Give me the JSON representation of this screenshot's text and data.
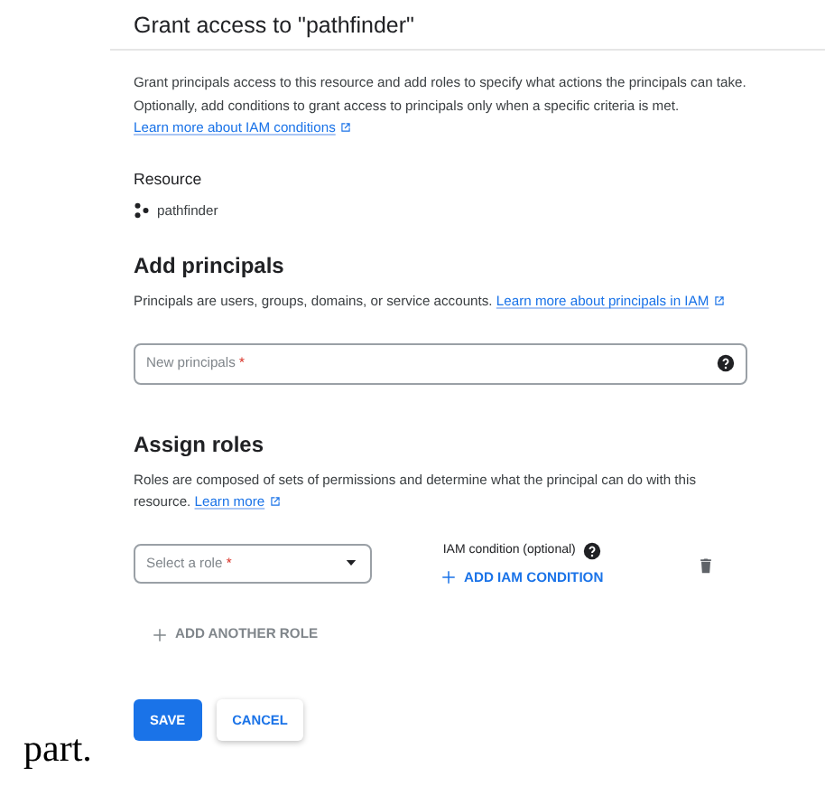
{
  "outside_text": "part.",
  "dialog": {
    "title": "Grant access to \"pathfinder\"",
    "intro": {
      "text": "Grant principals access to this resource and add roles to specify what actions the principals can take. Optionally, add conditions to grant access to principals only when a specific criteria is met.",
      "link": "Learn more about IAM conditions"
    },
    "resource": {
      "heading": "Resource",
      "name": "pathfinder"
    },
    "principals": {
      "heading": "Add principals",
      "text": "Principals are users, groups, domains, or service accounts.",
      "link": "Learn more about principals in IAM",
      "field": {
        "placeholder": "New principals",
        "required_mark": "*"
      }
    },
    "roles": {
      "heading": "Assign roles",
      "text": "Roles are composed of sets of permissions and determine what the principal can do with this resource.",
      "link": "Learn more",
      "role_select": {
        "placeholder": "Select a role",
        "required_mark": "*"
      },
      "condition_label": "IAM condition (optional)",
      "add_condition": "ADD IAM CONDITION",
      "add_role": "ADD ANOTHER ROLE"
    },
    "buttons": [
      {
        "label": "SAVE",
        "kind": "primary"
      },
      {
        "label": "CANCEL",
        "kind": "secondary"
      }
    ]
  }
}
